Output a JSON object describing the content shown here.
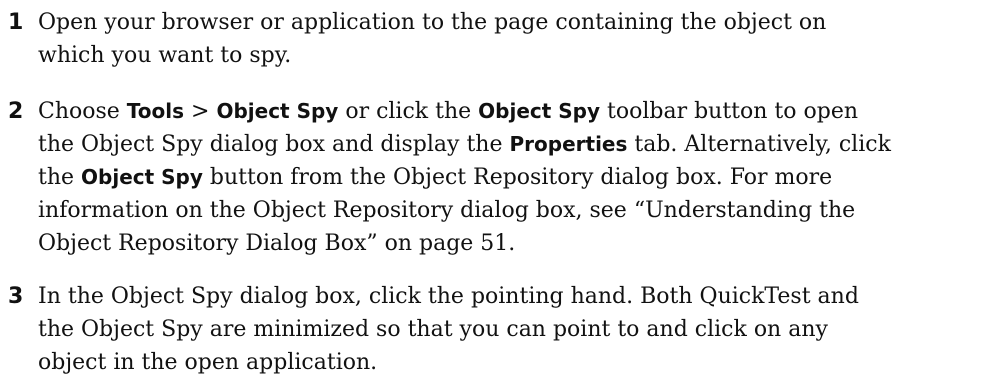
{
  "steps": [
    {
      "number": "1",
      "lines": [
        [
          {
            "t": "Open your browser or application to the page containing the object on",
            "b": false
          }
        ],
        [
          {
            "t": "which you want to spy.",
            "b": false
          }
        ]
      ]
    },
    {
      "number": "2",
      "lines": [
        [
          {
            "t": "Choose ",
            "b": false
          },
          {
            "t": "Tools",
            "b": true
          },
          {
            "t": " > ",
            "b": false
          },
          {
            "t": "Object Spy",
            "b": true
          },
          {
            "t": " or click the ",
            "b": false
          },
          {
            "t": "Object Spy",
            "b": true
          },
          {
            "t": " toolbar button to open",
            "b": false
          }
        ],
        [
          {
            "t": "the Object Spy dialog box and display the ",
            "b": false
          },
          {
            "t": "Properties",
            "b": true
          },
          {
            "t": " tab. Alternatively, click",
            "b": false
          }
        ],
        [
          {
            "t": "the ",
            "b": false
          },
          {
            "t": "Object Spy",
            "b": true
          },
          {
            "t": " button from the Object Repository dialog box. For more",
            "b": false
          }
        ],
        [
          {
            "t": "information on the Object Repository dialog box, see “Understanding the",
            "b": false
          }
        ],
        [
          {
            "t": "Object Repository Dialog Box” on page 51.",
            "b": false
          }
        ]
      ]
    },
    {
      "number": "3",
      "lines": [
        [
          {
            "t": "In the Object Spy dialog box, click the pointing hand. Both QuickTest and",
            "b": false
          }
        ],
        [
          {
            "t": "the Object Spy are minimized so that you can point to and click on any",
            "b": false
          }
        ],
        [
          {
            "t": "object in the open application.",
            "b": false
          }
        ]
      ]
    }
  ]
}
